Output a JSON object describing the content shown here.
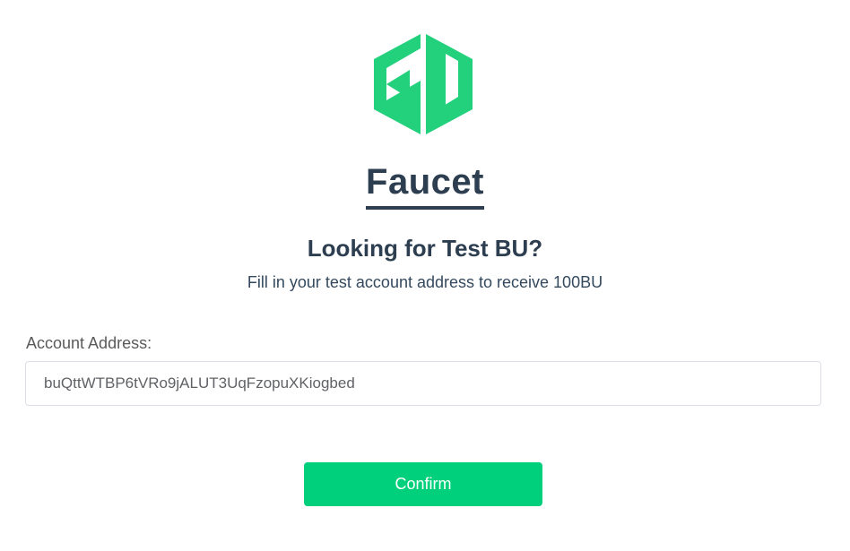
{
  "brand": {
    "logo_icon": "bu-hexagon-logo-icon",
    "color": "#23d07c"
  },
  "page": {
    "title": "Faucet",
    "heading": "Looking for Test BU?",
    "subtitle": "Fill in your test account address to receive 100BU"
  },
  "form": {
    "address_label": "Account Address:",
    "address_value": "buQttWTBP6tVRo9jALUT3UqFzopuXKiogbed",
    "confirm_label": "Confirm",
    "confirm_color": "#00cf7b"
  }
}
